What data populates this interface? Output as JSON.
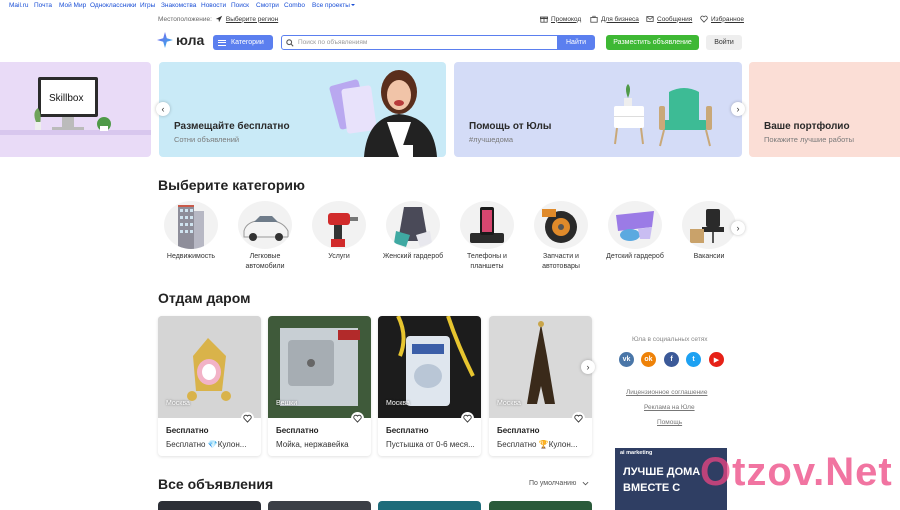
{
  "topnav": {
    "links": [
      "Mail.ru",
      "Почта",
      "Мой Мир",
      "Одноклассники",
      "Игры",
      "Знакомства",
      "Новости",
      "Поиск",
      "Смотри",
      "Combo",
      "Все проекты"
    ]
  },
  "subheader": {
    "location_label": "Местоположение:",
    "location_link": "Выберите регион",
    "promo": "Промокод",
    "business": "Для бизнеса",
    "messages": "Сообщения",
    "favorites": "Избранное"
  },
  "header": {
    "logo": "юла",
    "categories_button": "Категории",
    "search_placeholder": "Поиск по объявлениям",
    "search_button": "Найти",
    "post_button": "Разместить объявление",
    "login_button": "Войти"
  },
  "banners": [
    {
      "brand": "Skillbox",
      "title": "",
      "subtitle": ""
    },
    {
      "title": "Размещайте бесплатно",
      "subtitle": "Сотни объявлений"
    },
    {
      "title": "Помощь от Юлы",
      "subtitle": "#лучшедома"
    },
    {
      "title": "Ваше портфолио",
      "subtitle": "Покажите лучшие работы"
    }
  ],
  "categories_section": {
    "title": "Выберите категорию",
    "items": [
      "Недвижимость",
      "Легковые автомобили",
      "Услуги",
      "Женский гардероб",
      "Телефоны и планшеты",
      "Запчасти и автотовары",
      "Детский гардероб",
      "Вакансии"
    ]
  },
  "free_section": {
    "title": "Отдам даром",
    "cards": [
      {
        "location": "Москва",
        "price": "Бесплатно",
        "desc": "Бесплатно 💎Кулон..."
      },
      {
        "location": "Вешки",
        "price": "Бесплатно",
        "desc": "Мойка, нержавейка"
      },
      {
        "location": "Москва",
        "price": "Бесплатно",
        "desc": "Пустышка от 0-6 меся..."
      },
      {
        "location": "Москва",
        "price": "Бесплатно",
        "desc": "Бесплатно 🏆Кулон..."
      }
    ]
  },
  "sidebar": {
    "social_title": "Юла в социальных сетях",
    "socials": [
      {
        "name": "vk",
        "label": "vk",
        "color": "#4a76a8"
      },
      {
        "name": "ok",
        "label": "ok",
        "color": "#ee8208"
      },
      {
        "name": "facebook",
        "label": "f",
        "color": "#3b5998"
      },
      {
        "name": "twitter",
        "label": "t",
        "color": "#1da1f2"
      },
      {
        "name": "youtube",
        "label": "▶",
        "color": "#e62117"
      }
    ],
    "links": [
      "Лицензионное соглашение",
      "Реклама на Юле",
      "Помощь"
    ],
    "ad": {
      "tag": "ai marketing",
      "line1": "ЛУЧШЕ ДОМА",
      "line2": "ВМЕСТЕ С"
    },
    "watermark": "Otzov.Net"
  },
  "all_section": {
    "title": "Все объявления",
    "sort": "По умолчанию"
  },
  "colors": {
    "accent": "#5b7fef",
    "green": "#3eb834"
  }
}
